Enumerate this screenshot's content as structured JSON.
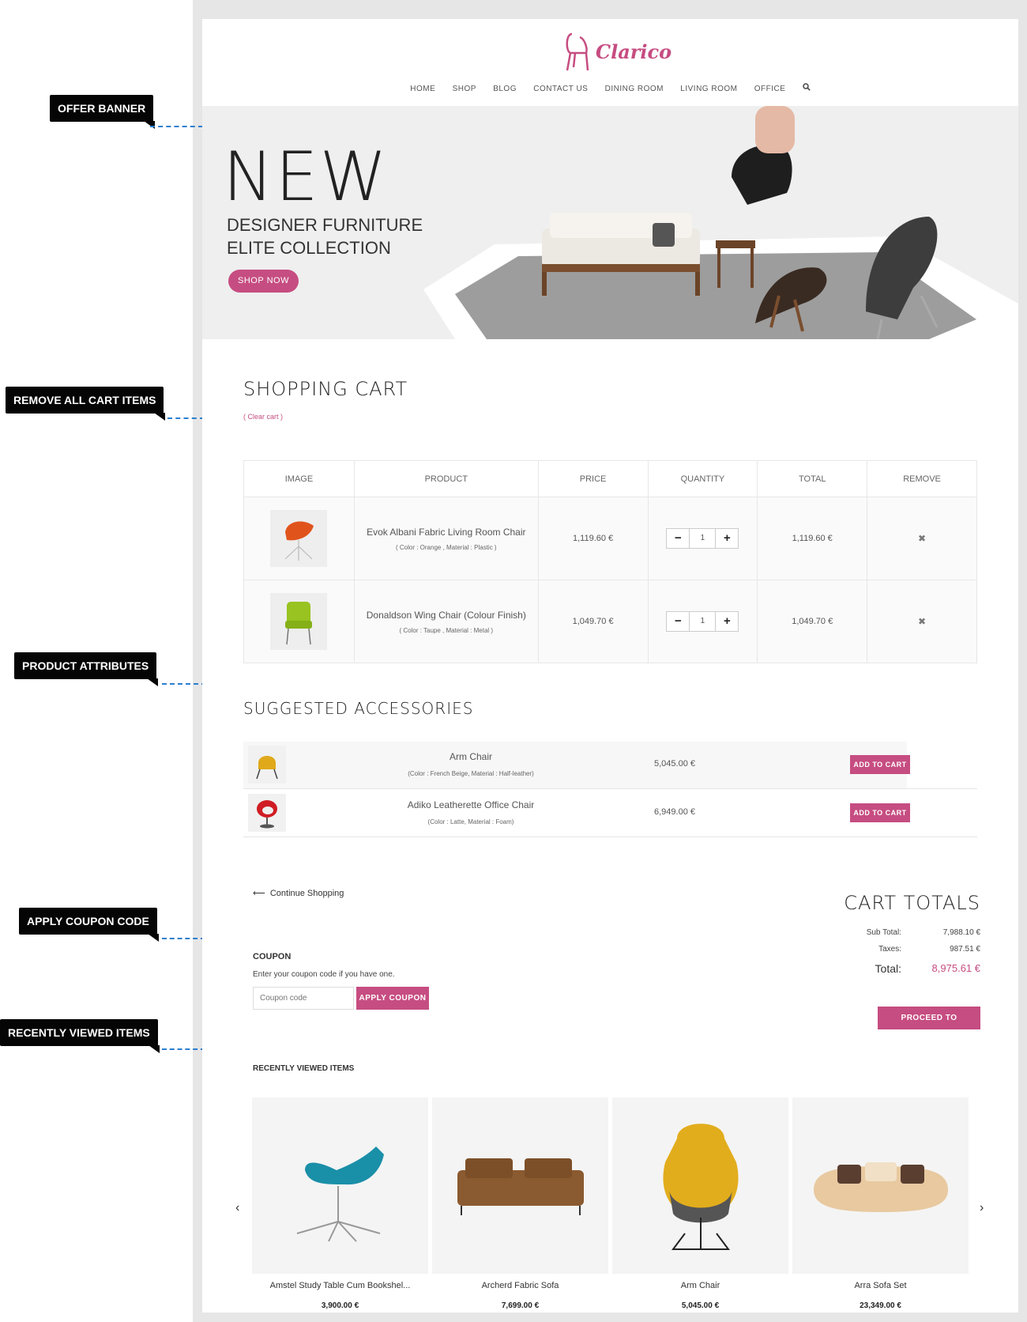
{
  "annotations": {
    "offer_banner": "OFFER BANNER",
    "remove_all": "REMOVE ALL CART ITEMS",
    "product_attributes": "PRODUCT ATTRIBUTES",
    "apply_coupon": "APPLY COUPON CODE",
    "recently_viewed": "RECENTLY VIEWED ITEMS"
  },
  "logo": {
    "text": "Clarico",
    "color": "#c64d81"
  },
  "nav": [
    "HOME",
    "SHOP",
    "BLOG",
    "CONTACT US",
    "DINING ROOM",
    "LIVING ROOM",
    "OFFICE"
  ],
  "hero": {
    "headline": "NEW",
    "line1": "DESIGNER FURNITURE",
    "line2": "ELITE COLLECTION",
    "cta": "SHOP NOW"
  },
  "cart": {
    "title": "SHOPPING CART",
    "clear": "( Clear cart )",
    "headers": [
      "IMAGE",
      "PRODUCT",
      "PRICE",
      "QUANTITY",
      "TOTAL",
      "REMOVE"
    ],
    "items": [
      {
        "name": "Evok Albani Fabric Living Room Chair",
        "attrs": "( Color : Orange , Material : Plastic )",
        "price": "1,119.60 €",
        "qty": "1",
        "total": "1,119.60 €"
      },
      {
        "name": "Donaldson Wing Chair (Colour Finish)",
        "attrs": "( Color : Taupe , Material : Metal )",
        "price": "1,049.70 €",
        "qty": "1",
        "total": "1,049.70 €"
      }
    ]
  },
  "suggested": {
    "title": "SUGGESTED ACCESSORIES",
    "items": [
      {
        "name": "Arm Chair",
        "attrs": "(Color : French Beige, Material : Half-leather)",
        "price": "5,045.00 €",
        "button": "ADD TO CART"
      },
      {
        "name": "Adiko Leatherette Office Chair",
        "attrs": "(Color : Latte, Material : Foam)",
        "price": "6,949.00 €",
        "button": "ADD TO CART"
      }
    ]
  },
  "continue_shopping": "Continue Shopping",
  "coupon": {
    "heading": "COUPON",
    "text": "Enter your coupon code if you have one.",
    "placeholder": "Coupon code",
    "button": "APPLY COUPON"
  },
  "totals": {
    "title": "CART TOTALS",
    "subtotal_label": "Sub Total:",
    "subtotal": "7,988.10 €",
    "taxes_label": "Taxes:",
    "taxes": "987.51 €",
    "total_label": "Total:",
    "total": "8,975.61 €",
    "checkout": "PROCEED TO CHECKOUT"
  },
  "recently_viewed": {
    "title": "RECENTLY VIEWED ITEMS",
    "items": [
      {
        "name": "Amstel Study Table Cum Bookshel...",
        "price": "3,900.00 €"
      },
      {
        "name": "Archerd Fabric Sofa",
        "price": "7,699.00 €"
      },
      {
        "name": "Arm Chair",
        "price": "5,045.00 €"
      },
      {
        "name": "Arra Sofa Set",
        "price": "23,349.00 €"
      }
    ]
  }
}
